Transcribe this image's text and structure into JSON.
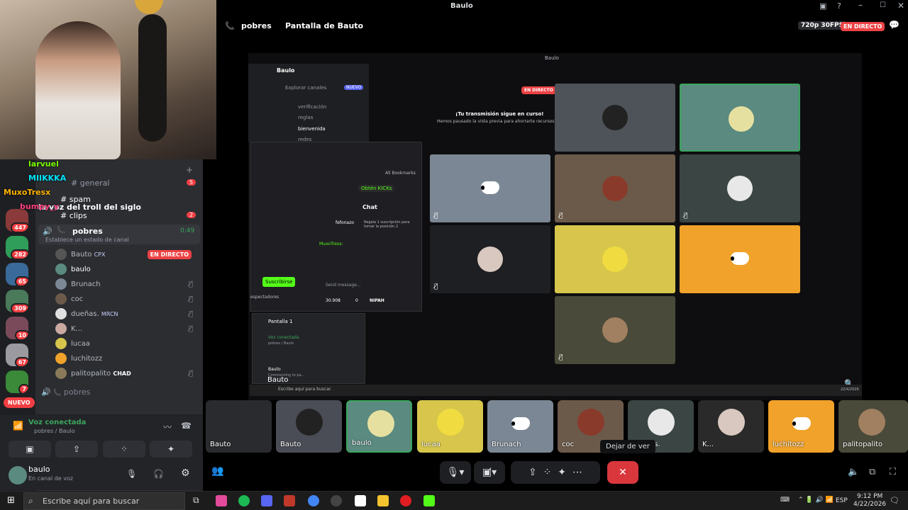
{
  "window": {
    "title": "Baulo"
  },
  "header": {
    "call_channel": "pobres",
    "screen_title": "Pantalla de Bauto",
    "quality": "720p 30FPS",
    "live_badge": "EN DIRECTO"
  },
  "overlay_chat": [
    {
      "user": "larvuel",
      "color": "#7cfc00"
    },
    {
      "user": "MIIKKKA",
      "color": "#00e5ff"
    },
    {
      "user": "MuxoTresx",
      "color": "#ffb300"
    },
    {
      "user": "bumpy_y",
      "color": "#ff4081"
    }
  ],
  "channels": {
    "items": [
      {
        "label": "general",
        "badge": "5"
      },
      {
        "label": "spam"
      },
      {
        "label": "la voz del troll del siglo"
      },
      {
        "label": "clips",
        "badge": "2"
      }
    ],
    "voice": {
      "name": "pobres",
      "time": "0:49",
      "status_placeholder": "Establece un estado de canal"
    },
    "members": [
      {
        "name": "Bauto",
        "tag": "CPX",
        "live": "EN DIRECTO"
      },
      {
        "name": "baulo"
      },
      {
        "name": "Brunach"
      },
      {
        "name": "coc"
      },
      {
        "name": "dueñas.",
        "tag": "MRCN"
      },
      {
        "name": "K..."
      },
      {
        "name": "lucaa"
      },
      {
        "name": "luchitozz"
      },
      {
        "name": "palitopalito",
        "tag": "CHAD"
      }
    ],
    "voice2": {
      "name": "pobres"
    }
  },
  "server_badges": [
    "447",
    "282",
    "65",
    "309",
    "10",
    "67",
    "7"
  ],
  "server_new": "NUEVO",
  "voice_panel": {
    "status": "Voz conectada",
    "sub": "pobres / Baulo"
  },
  "user": {
    "name": "baulo",
    "status": "En canal de voz"
  },
  "stage": {
    "inner_title": "Baulo",
    "live": "EN DIRECTO",
    "msg_title": "¡Tu transmisión sigue en curso!",
    "msg_body": "Hemos pausado la vista previa para ahorrarte recursos.",
    "server": "Baulo",
    "explore": "Explorar canales",
    "explore_badge": "NUEVO",
    "inner_channels": [
      "verificación",
      "reglas",
      "bienvenida",
      "redes"
    ],
    "kick": {
      "chat": "Chat",
      "obtain": "Obtén KICKs",
      "subscribe": "Suscribirse",
      "viewers": "espectadores",
      "send": "Send message...",
      "user1": "fefonazo",
      "gift": "Regala 1 suscripción para tomar la posición 2",
      "count": "30.908",
      "count2": "0",
      "tag": "NIPAH",
      "bookmarks": "All Bookmarks",
      "chat_user": "MuxoTresx:"
    },
    "mini": {
      "title": "Pantalla 1",
      "status": "Voz conectada",
      "sub": "pobres / Baulo",
      "user": "Bauto",
      "user_sub": "Commenting to pa..."
    },
    "mini_search": "Escribe aquí para buscar.",
    "mini_name": "Bauto",
    "mini_date": "22/4/2026"
  },
  "strip": [
    {
      "label": "Bauto",
      "bg": "#2a2b2f"
    },
    {
      "label": "Bauto",
      "bg": "#4a4d55"
    },
    {
      "label": "baulo",
      "bg": "#5a8a80"
    },
    {
      "label": "lucaa",
      "bg": "#d7c64b"
    },
    {
      "label": "Brunach",
      "bg": "#7b8794"
    },
    {
      "label": "coc",
      "bg": "#6b5a4a"
    },
    {
      "label": "dueñas.",
      "bg": "#3a4544"
    },
    {
      "label": "K...",
      "bg": "#2a2a2a"
    },
    {
      "label": "luchitozz",
      "bg": "#f0a22a"
    },
    {
      "label": "palitopalito",
      "bg": "#4a4a3a"
    }
  ],
  "tooltip": "Dejar de ver",
  "taskbar": {
    "search": "Escribe aquí para buscar",
    "lang": "ESP",
    "time": "9:12 PM",
    "date": "4/22/2026"
  }
}
